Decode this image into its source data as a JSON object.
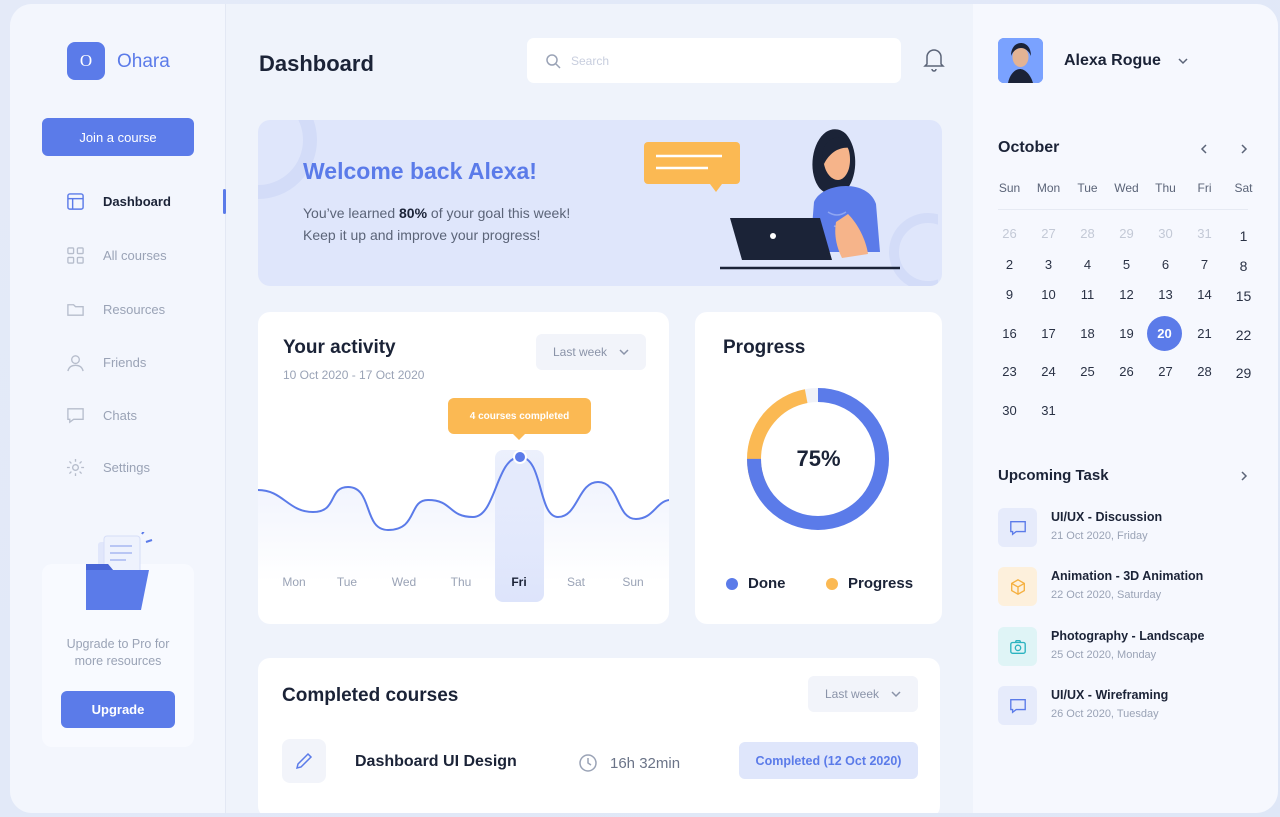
{
  "brand": {
    "logo_letter": "O",
    "name": "Ohara"
  },
  "sidebar": {
    "join_label": "Join a course",
    "items": [
      {
        "label": "Dashboard",
        "icon": "layout-icon"
      },
      {
        "label": "All courses",
        "icon": "grid-icon"
      },
      {
        "label": "Resources",
        "icon": "folder-icon"
      },
      {
        "label": "Friends",
        "icon": "user-icon"
      },
      {
        "label": "Chats",
        "icon": "chat-icon"
      },
      {
        "label": "Settings",
        "icon": "gear-icon"
      }
    ],
    "active_item": "Dashboard",
    "upgrade": {
      "text": "Upgrade to Pro for more resources",
      "button": "Upgrade"
    }
  },
  "header": {
    "title": "Dashboard",
    "search_placeholder": "Search"
  },
  "welcome": {
    "title": "Welcome back Alexa!",
    "line1_pre": "You’ve learned ",
    "line1_pct": "80%",
    "line1_post": " of your goal this week!",
    "line2": "Keep it up and improve your progress!"
  },
  "activity": {
    "title": "Your activity",
    "date_range": "10 Oct 2020 - 17 Oct 2020",
    "filter": "Last week",
    "tooltip": "4 courses completed",
    "days": [
      "Mon",
      "Tue",
      "Wed",
      "Thu",
      "Fri",
      "Sat",
      "Sun"
    ],
    "selected_day": "Fri"
  },
  "progress": {
    "title": "Progress",
    "percent_label": "75%",
    "done_fraction": 0.75,
    "legend_done": "Done",
    "legend_progress": "Progress"
  },
  "completed": {
    "title": "Completed courses",
    "filter": "Last week",
    "course": {
      "name": "Dashboard UI Design",
      "duration": "16h 32min",
      "status": "Completed (12 Oct 2020)"
    }
  },
  "user": {
    "name": "Alexa Rogue"
  },
  "calendar": {
    "month": "October",
    "weekdays": [
      "Sun",
      "Mon",
      "Tue",
      "Wed",
      "Thu",
      "Fri",
      "Sat"
    ],
    "weeks": [
      [
        "26",
        "27",
        "28",
        "29",
        "30",
        "31",
        "1"
      ],
      [
        "2",
        "3",
        "4",
        "5",
        "6",
        "7",
        "8"
      ],
      [
        "9",
        "10",
        "11",
        "12",
        "13",
        "14",
        "15"
      ],
      [
        "16",
        "17",
        "18",
        "19",
        "20",
        "21",
        "22"
      ],
      [
        "23",
        "24",
        "25",
        "26",
        "27",
        "28",
        "29"
      ],
      [
        "30",
        "31"
      ]
    ],
    "today": "20"
  },
  "tasks": {
    "heading": "Upcoming Task",
    "items": [
      {
        "title": "UI/UX - Discussion",
        "date": "21 Oct 2020, Friday",
        "icon": "chat-icon",
        "color": "#5b7be9",
        "bg": "#e6ebfb"
      },
      {
        "title": "Animation - 3D Animation",
        "date": "22 Oct 2020, Saturday",
        "icon": "cube-icon",
        "color": "#f5b041",
        "bg": "#fdf0dc"
      },
      {
        "title": "Photography - Landscape",
        "date": "25 Oct 2020, Monday",
        "icon": "camera-icon",
        "color": "#2bb3c0",
        "bg": "#dff4f6"
      },
      {
        "title": "UI/UX - Wireframing",
        "date": "26 Oct 2020, Tuesday",
        "icon": "chat-icon",
        "color": "#5b7be9",
        "bg": "#e6ebfb"
      }
    ]
  },
  "colors": {
    "accent": "#5b7be9",
    "orange": "#fbb953"
  }
}
